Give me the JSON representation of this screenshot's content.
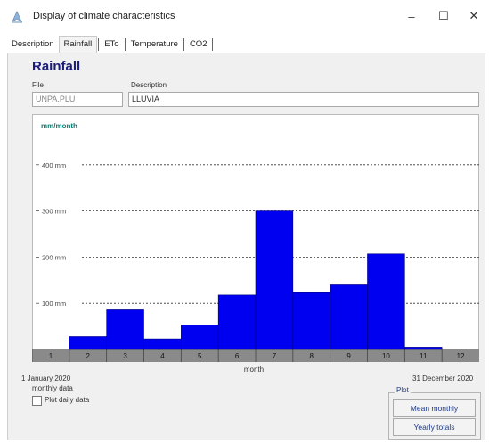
{
  "window": {
    "title": "Display of climate characteristics",
    "minimize": "–",
    "maximize": "☐",
    "close": "✕"
  },
  "tabs": [
    {
      "label": "Description",
      "active": false
    },
    {
      "label": "Rainfall",
      "active": true
    },
    {
      "label": "ETo",
      "active": false
    },
    {
      "label": "Temperature",
      "active": false
    },
    {
      "label": "CO2",
      "active": false
    }
  ],
  "heading": "Rainfall",
  "file": {
    "label": "File",
    "value": "UNPA.PLU"
  },
  "description": {
    "label": "Description",
    "value": "LLUVIA"
  },
  "chart_data": {
    "type": "bar",
    "ylabel": "mm/month",
    "xlabel": "month",
    "categories": [
      "1",
      "2",
      "3",
      "4",
      "5",
      "6",
      "7",
      "8",
      "9",
      "10",
      "11",
      "12"
    ],
    "values": [
      0,
      28,
      86,
      23,
      53,
      118,
      300,
      123,
      140,
      207,
      5,
      0
    ],
    "ylim": [
      0,
      450
    ],
    "yticks": [
      {
        "value": 100,
        "label": "100 mm"
      },
      {
        "value": 200,
        "label": "200 mm"
      },
      {
        "value": 300,
        "label": "300 mm"
      },
      {
        "value": 400,
        "label": "400 mm"
      }
    ],
    "bar_color": "#0000f0",
    "grid": "dashed horizontal"
  },
  "period": {
    "start": "1 January 2020",
    "end": "31 December 2020"
  },
  "data_type": "monthly data",
  "plot_daily": {
    "label": "Plot daily data",
    "checked": false
  },
  "plot_group": {
    "title": "Plot",
    "mean_monthly": "Mean monthly",
    "yearly_totals": "Yearly totals"
  }
}
